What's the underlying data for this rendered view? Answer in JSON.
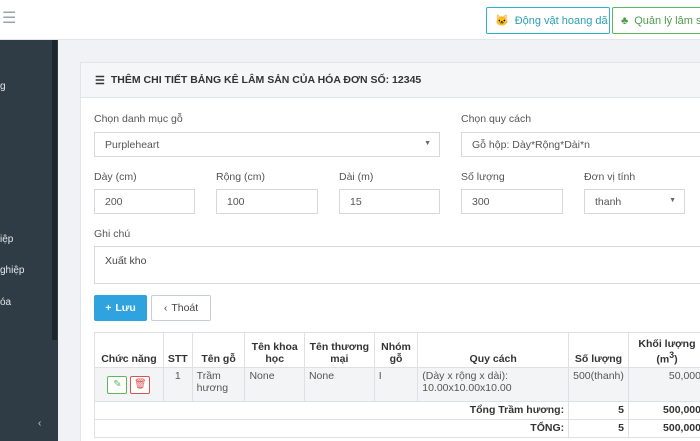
{
  "topbar": {
    "menu_icon": "hamburger-icon",
    "animal_button": "Động vật hoang dã",
    "forest_button": "Quản lý lâm sả"
  },
  "sidebar": {
    "items": [
      {
        "label": "g"
      },
      {
        "label": "iệp"
      },
      {
        "label": "ghiệp"
      },
      {
        "label": "óa"
      }
    ],
    "collapse": "‹"
  },
  "panel": {
    "title": "THÊM CHI TIẾT BẢNG KÊ LÂM SẢN CỦA HÓA ĐƠN SỐ: 12345"
  },
  "form": {
    "category_label": "Chọn danh mục gỗ",
    "category_value": "Purpleheart",
    "spec_label": "Chọn quy cách",
    "spec_value": "Gỗ hộp: Dày*Rộng*Dài*n",
    "thickness_label": "Dày (cm)",
    "thickness_value": "200",
    "width_label": "Rộng (cm)",
    "width_value": "100",
    "length_label": "Dài (m)",
    "length_value": "15",
    "quantity_label": "Số lượng",
    "quantity_value": "300",
    "unit_label": "Đơn vị tính",
    "unit_value": "thanh",
    "note_label": "Ghi chú",
    "note_value": "Xuất kho",
    "save_button": "Lưu",
    "exit_button": "Thoát"
  },
  "table": {
    "headers": {
      "actions": "Chức năng",
      "stt": "STT",
      "wood_name": "Tên gỗ",
      "scientific_name": "Tên khoa học",
      "trade_name": "Tên thương mại",
      "group": "Nhóm gỗ",
      "spec": "Quy cách",
      "quantity": "Số lượng",
      "volume": "Khối lượng (m",
      "volume_sup": "3",
      "volume_close": ")"
    },
    "rows": [
      {
        "stt": "1",
        "wood_name": "Trầm hương",
        "scientific_name": "None",
        "trade_name": "None",
        "group": "I",
        "spec": "(Dày x rộng x dài): 10.00x10.00x10.00",
        "quantity": "500(thanh)",
        "volume": "50,000"
      }
    ],
    "subtotal": {
      "label": "Tổng Trầm hương:",
      "quantity": "5",
      "volume": "500,000"
    },
    "total": {
      "label": "TỔNG:",
      "quantity": "5",
      "volume": "500,000"
    }
  }
}
